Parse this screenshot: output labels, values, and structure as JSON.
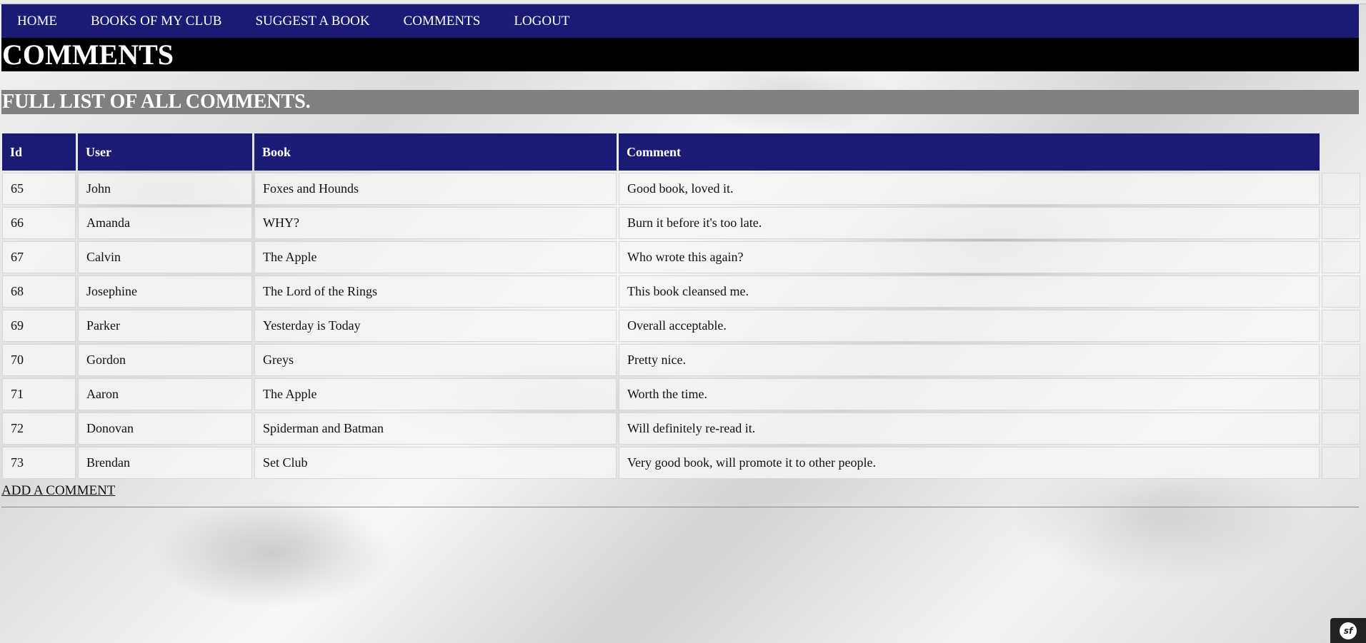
{
  "nav": {
    "items": [
      {
        "label": "HOME"
      },
      {
        "label": "BOOKS OF MY CLUB"
      },
      {
        "label": "SUGGEST A BOOK"
      },
      {
        "label": "COMMENTS"
      },
      {
        "label": "LOGOUT"
      }
    ]
  },
  "page": {
    "title": "COMMENTS",
    "subtitle": "FULL LIST OF ALL COMMENTS."
  },
  "table": {
    "headers": [
      "Id",
      "User",
      "Book",
      "Comment"
    ],
    "rows": [
      {
        "id": "65",
        "user": "John",
        "book": "Foxes and Hounds",
        "comment": "Good book, loved it."
      },
      {
        "id": "66",
        "user": "Amanda",
        "book": "WHY?",
        "comment": "Burn it before it's too late."
      },
      {
        "id": "67",
        "user": "Calvin",
        "book": "The Apple",
        "comment": "Who wrote this again?"
      },
      {
        "id": "68",
        "user": "Josephine",
        "book": "The Lord of the Rings",
        "comment": "This book cleansed me."
      },
      {
        "id": "69",
        "user": "Parker",
        "book": "Yesterday is Today",
        "comment": "Overall acceptable."
      },
      {
        "id": "70",
        "user": "Gordon",
        "book": "Greys",
        "comment": "Pretty nice."
      },
      {
        "id": "71",
        "user": "Aaron",
        "book": "The Apple",
        "comment": "Worth the time."
      },
      {
        "id": "72",
        "user": "Donovan",
        "book": "Spiderman and Batman",
        "comment": "Will definitely re-read it."
      },
      {
        "id": "73",
        "user": "Brendan",
        "book": "Set Club",
        "comment": "Very good book, will promote it to other people."
      }
    ]
  },
  "footer": {
    "add_link": "ADD A COMMENT"
  },
  "toolbar": {
    "logo_text": "sf",
    "icon": "symfony-logo-icon"
  },
  "colors": {
    "nav_bg": "#1b1a75",
    "title_bg": "#000000",
    "subtitle_bg": "#808080",
    "header_bg": "#1b1a75"
  }
}
